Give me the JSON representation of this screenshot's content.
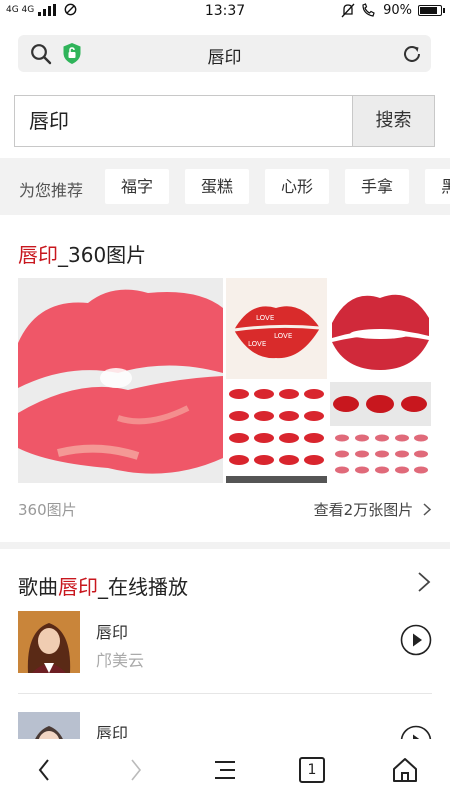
{
  "status": {
    "network": "4G 4G",
    "time": "13:37",
    "battery": "90%",
    "battery_level": 0.9
  },
  "address_bar": {
    "title": "唇印"
  },
  "search": {
    "value": "唇印",
    "button_label": "搜索"
  },
  "recommend": {
    "label": "为您推荐",
    "chips": [
      "福字",
      "蛋糕",
      "心形",
      "手拿",
      "黑"
    ]
  },
  "images": {
    "title_highlight": "唇印",
    "title_rest": "_360图片",
    "source": "360图片",
    "more_link": "查看2万张图片",
    "colors": {
      "lip_red": "#ee4f5e",
      "deep_red": "#c8171e"
    }
  },
  "songs": {
    "title_prefix": "歌曲",
    "title_highlight": "唇印",
    "title_rest": "_在线播放",
    "items": [
      {
        "name": "唇印",
        "artist": "邝美云"
      },
      {
        "name": "唇印",
        "artist": ""
      }
    ]
  },
  "nav": {
    "tab_count": "1"
  }
}
